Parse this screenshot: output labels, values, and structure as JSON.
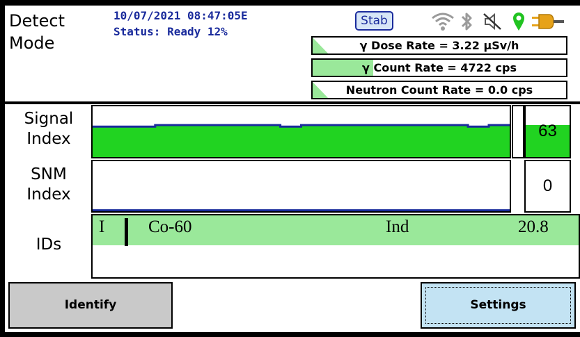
{
  "header": {
    "mode_line1": "Detect",
    "mode_line2": "Mode",
    "datetime": "10/07/2021 08:47:05E",
    "status": "Status: Ready 12%",
    "stab_badge": "Stab"
  },
  "status_icons": [
    "wifi-icon",
    "bluetooth-icon",
    "speaker-muted-icon",
    "location-pin-icon",
    "power-plug-icon"
  ],
  "rates": {
    "dose": "γ Dose Rate = 3.22  µSv/h",
    "count": "γ Count Rate = 4722 cps",
    "neutron": "Neutron Count Rate = 0.0 cps",
    "count_fill_fraction": 0.24
  },
  "signal_index": {
    "label_line1": "Signal",
    "label_line2": "Index",
    "value": "63",
    "value_fill_fraction": 0.63,
    "history_fraction": [
      0.6,
      0.6,
      0.6,
      0.63,
      0.63,
      0.63,
      0.63,
      0.63,
      0.63,
      0.6,
      0.63,
      0.63,
      0.63,
      0.63,
      0.63,
      0.63,
      0.63,
      0.63,
      0.6,
      0.63
    ]
  },
  "snm_index": {
    "label_line1": "SNM",
    "label_line2": "Index",
    "value": "0",
    "value_fill_fraction": 0.0,
    "history_fraction": [
      0.02,
      0.02,
      0.02,
      0.02,
      0.02,
      0.02,
      0.02,
      0.02,
      0.02,
      0.02,
      0.02,
      0.02,
      0.02,
      0.02,
      0.02,
      0.02,
      0.02,
      0.02,
      0.02,
      0.02
    ]
  },
  "ids": {
    "label": "IDs",
    "rows": [
      {
        "flag": "I",
        "nuclide": "Co-60",
        "category": "Ind",
        "confidence": "20.8"
      }
    ]
  },
  "buttons": {
    "identify": "Identify",
    "settings": "Settings"
  },
  "colors": {
    "accent_blue": "#1a2b9c",
    "signal_green": "#21d321",
    "id_row_green": "#9ae89a",
    "rate_green": "#9ae89a"
  }
}
